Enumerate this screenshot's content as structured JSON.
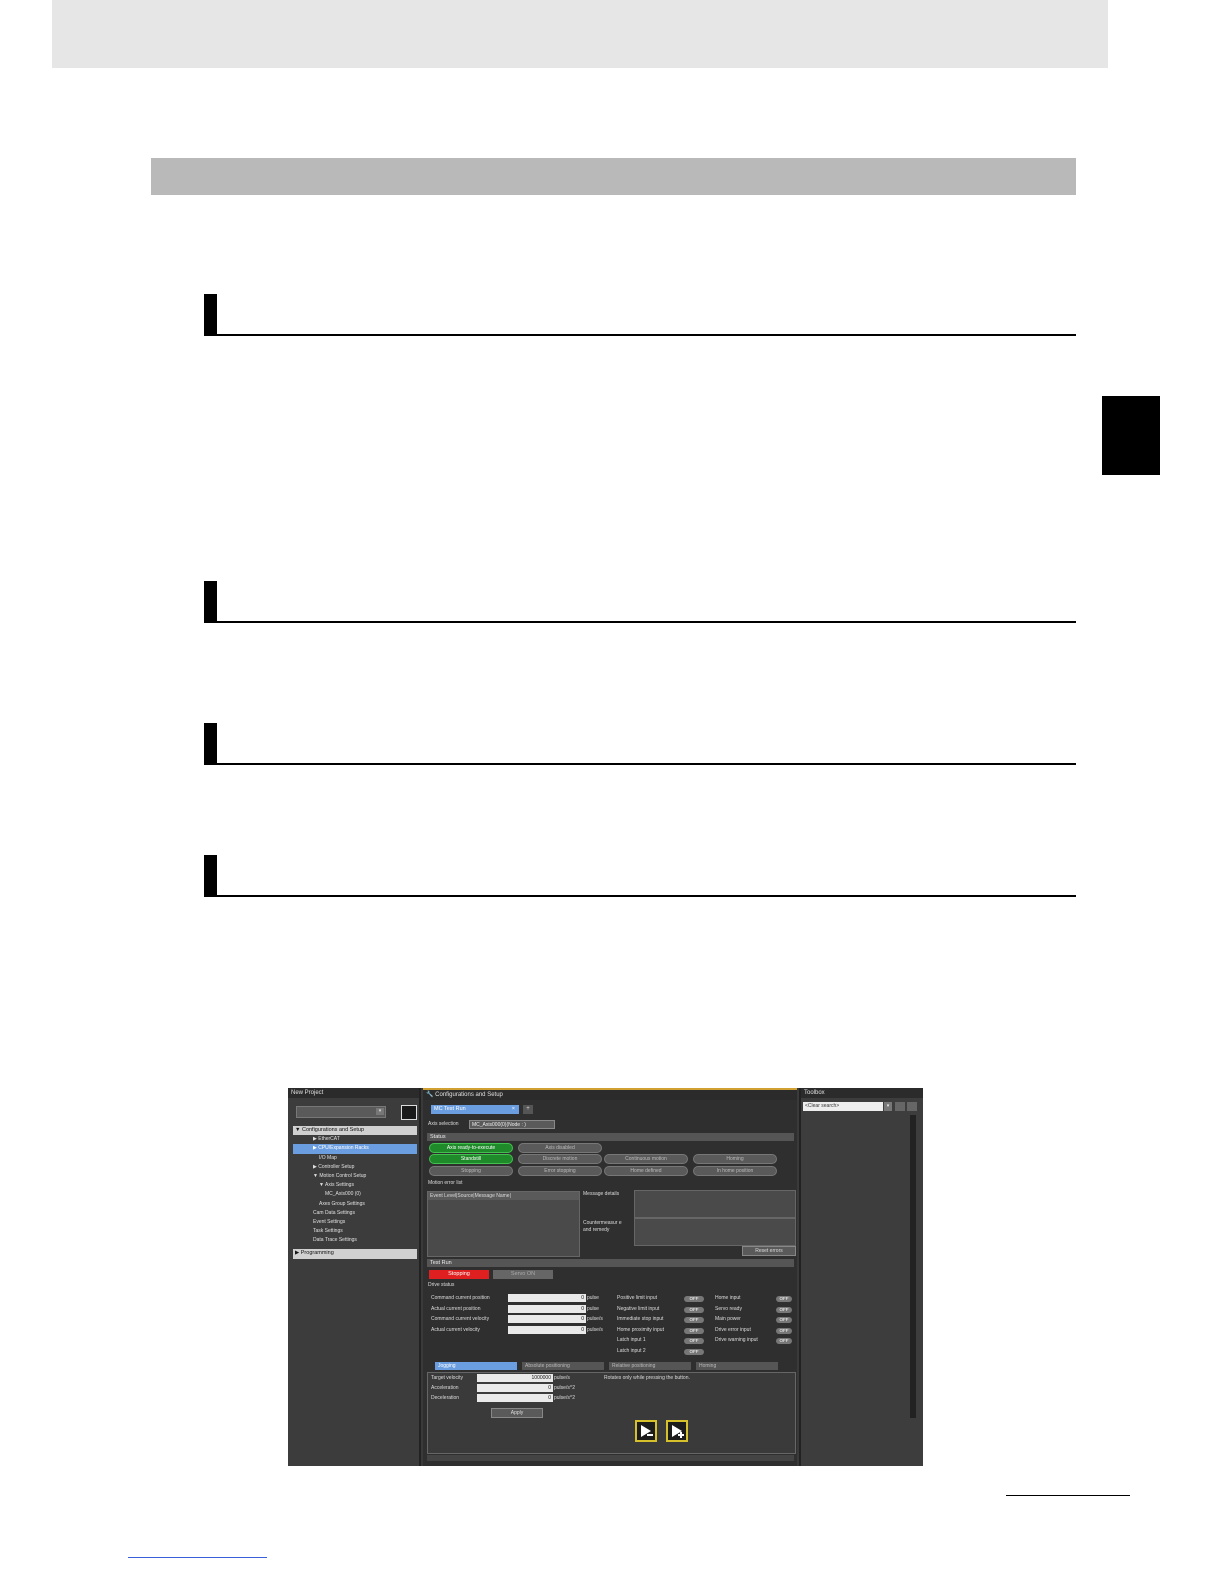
{
  "screenshot": {
    "left_pane": {
      "title": "New Project",
      "tree": [
        {
          "label": "▼ Configurations and Setup",
          "kind": "group"
        },
        {
          "label": "▶ EtherCAT",
          "kind": "item",
          "indent": 1
        },
        {
          "label": "▶ CPU/Expansion Racks",
          "kind": "selected",
          "indent": 1
        },
        {
          "label": "I/O Map",
          "kind": "item",
          "indent": 2
        },
        {
          "label": "▶ Controller Setup",
          "kind": "item",
          "indent": 1
        },
        {
          "label": "▼ Motion Control Setup",
          "kind": "item",
          "indent": 1
        },
        {
          "label": "▼ Axis Settings",
          "kind": "item",
          "indent": 2
        },
        {
          "label": "MC_Axis000 (0)",
          "kind": "item",
          "indent": 3
        },
        {
          "label": "Axes Group Settings",
          "kind": "item",
          "indent": 2
        },
        {
          "label": "Cam Data Settings",
          "kind": "item",
          "indent": 1
        },
        {
          "label": "Event Settings",
          "kind": "item",
          "indent": 1
        },
        {
          "label": "Task Settings",
          "kind": "item",
          "indent": 1
        },
        {
          "label": "Data Trace Settings",
          "kind": "item",
          "indent": 1
        },
        {
          "label": "▶ Programming",
          "kind": "group"
        }
      ]
    },
    "center_pane": {
      "title": "Configurations and Setup",
      "tab": "MC Test Run",
      "axis_selection_label": "Axis selection",
      "axis_selection_value": "MC_Axis000(0)(Node : )",
      "status_header": "Status",
      "status_buttons": [
        {
          "label": "Axis ready-to-execute",
          "on": true
        },
        {
          "label": "Axis disabled",
          "on": false
        },
        {
          "label": "Standstill",
          "on": true
        },
        {
          "label": "Discrete motion",
          "on": false
        },
        {
          "label": "Continuous motion",
          "on": false
        },
        {
          "label": "Homing",
          "on": false
        },
        {
          "label": "Stopping",
          "on": false
        },
        {
          "label": "Error stopping",
          "on": false
        },
        {
          "label": "Home defined",
          "on": false
        },
        {
          "label": "In home position",
          "on": false
        }
      ],
      "motion_error_list_label": "Motion error list",
      "error_columns": "Event Level|Source|Message Name|",
      "message_details_label": "Message details",
      "countermeasure_label": "Countermeasur e and remedy",
      "reset_errors_label": "Reset errors",
      "test_run_header": "Test Run",
      "stopping_label": "Stopping",
      "servo_on_label": "Servo ON",
      "drive_status_label": "Drive status",
      "drive_rows": [
        {
          "label": "Command current position",
          "value": "0",
          "unit": "pulse"
        },
        {
          "label": "Actual current position",
          "value": "0",
          "unit": "pulse"
        },
        {
          "label": "Command current velocity",
          "value": "0",
          "unit": "pulse/s"
        },
        {
          "label": "Actual current velocity",
          "value": "0",
          "unit": "pulse/s"
        }
      ],
      "io_col1": [
        "Positive limit input",
        "Negative limit input",
        "Immediate stop input",
        "Home proximity input",
        "Latch input 1",
        "Latch input 2"
      ],
      "io_col2": [
        "Home input",
        "Servo ready",
        "Main power",
        "Drive error input",
        "Drive warning input"
      ],
      "off_label": "OFF",
      "mode_tabs": [
        "Jogging",
        "Absolute positioning",
        "Relative positioning",
        "Homing"
      ],
      "jog_fields": [
        {
          "label": "Target velocity",
          "value": "1000000",
          "unit": "pulse/s"
        },
        {
          "label": "Acceleration",
          "value": "0",
          "unit": "pulse/s^2"
        },
        {
          "label": "Deceleration",
          "value": "0",
          "unit": "pulse/s^2"
        }
      ],
      "jog_note": "Rotates only while pressing the button.",
      "apply_label": "Apply"
    },
    "right_pane": {
      "title": "Toolbox",
      "search_placeholder": "<Clear search>"
    }
  }
}
